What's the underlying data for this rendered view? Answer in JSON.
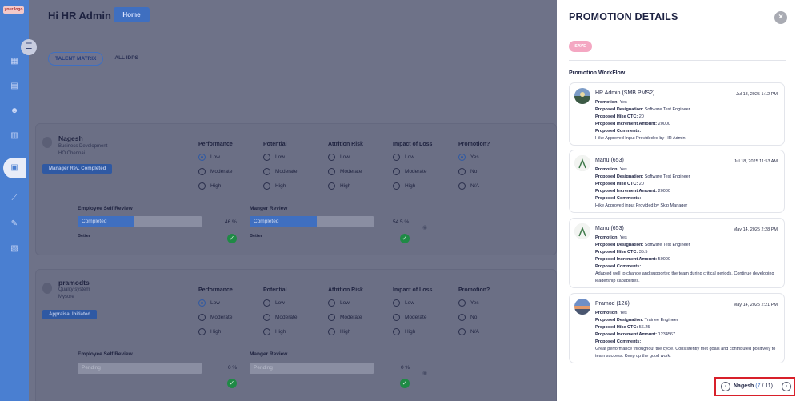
{
  "app": {
    "logo_text": "your logo"
  },
  "header": {
    "greeting": "Hi HR Admin",
    "home_label": "Home"
  },
  "tabs": [
    {
      "label": "TALENT MATRIX"
    },
    {
      "label": "ALL IDPS"
    }
  ],
  "columns": {
    "performance": "Performance",
    "potential": "Potential",
    "attrition": "Attrition Risk",
    "impact": "Impact of Loss",
    "promotion": "Promotion?"
  },
  "options": {
    "low": "Low",
    "moderate": "Moderate",
    "high": "High",
    "yes": "Yes",
    "no": "No",
    "na": "N/A"
  },
  "review_labels": {
    "self": "Employee Self Review",
    "manager": "Manger Review"
  },
  "employees": [
    {
      "name": "Nagesh",
      "dept": "Business Development",
      "location": "HO Chennai",
      "status": "Manager Rev. Completed",
      "self_status": "Completed",
      "self_pct": "46 %",
      "self_fill": 46,
      "self_rating": "Better",
      "mgr_status": "Completed",
      "mgr_pct": "54.5 %",
      "mgr_fill": 54.5,
      "mgr_rating": "Better"
    },
    {
      "name": "pramodts",
      "dept": "Quality system",
      "location": "Mysore",
      "status": "Appraisal Initiated",
      "self_status": "Pending",
      "self_pct": "0 %",
      "self_fill": 0,
      "mgr_status": "Pending",
      "mgr_pct": "0 %",
      "mgr_fill": 0
    }
  ],
  "panel": {
    "title": "PROMOTION DETAILS",
    "save_label": "SAVE",
    "workflow_heading": "Promotion WorkFlow",
    "labels": {
      "promotion": "Promotion:",
      "designation": "Proposed Designation:",
      "hike": "Proposed Hike CTC:",
      "increment": "Proposed Increment Amount:",
      "comments": "Proposed Comments:"
    },
    "entries": [
      {
        "name": "HR Admin (SMB PMS2)",
        "date": "Jul 18, 2025 1:12 PM",
        "promotion": "Yes",
        "designation": "Software Test Engineer",
        "hike": "20",
        "increment": "20000",
        "comment": "Hike Approved Input Provideded by HR Admin"
      },
      {
        "name": "Manu (653)",
        "date": "Jul 18, 2025 11:53 AM",
        "promotion": "Yes",
        "designation": "Software Test Engineer",
        "hike": "20",
        "increment": "20000",
        "comment": "Hike Approved input Provided by Skip Manager"
      },
      {
        "name": "Manu (653)",
        "date": "May 14, 2025 2:28 PM",
        "promotion": "Yes",
        "designation": "Software Test Engineer",
        "hike": "35.5",
        "increment": "50000",
        "comment": "Adapted well to change and supported the team during critical periods. Continue developing leadership capabilities."
      },
      {
        "name": "Pramod (126)",
        "date": "May 14, 2025 2:21 PM",
        "promotion": "Yes",
        "designation": "Trainee Engineer",
        "hike": "56.25",
        "increment": "1234567",
        "comment": "Great performance throughout the cycle. Consistently met goals and contributed positively to team success. Keep up the good work."
      }
    ],
    "pager": {
      "name": "Nagesh",
      "open": "(",
      "current": "7",
      "sep": "/",
      "total": "11)"
    }
  },
  "colors": {
    "accent": "#3f6fc0",
    "save": "#f4a7c2",
    "check": "#1f8a45",
    "highlight": "#d8202a"
  }
}
